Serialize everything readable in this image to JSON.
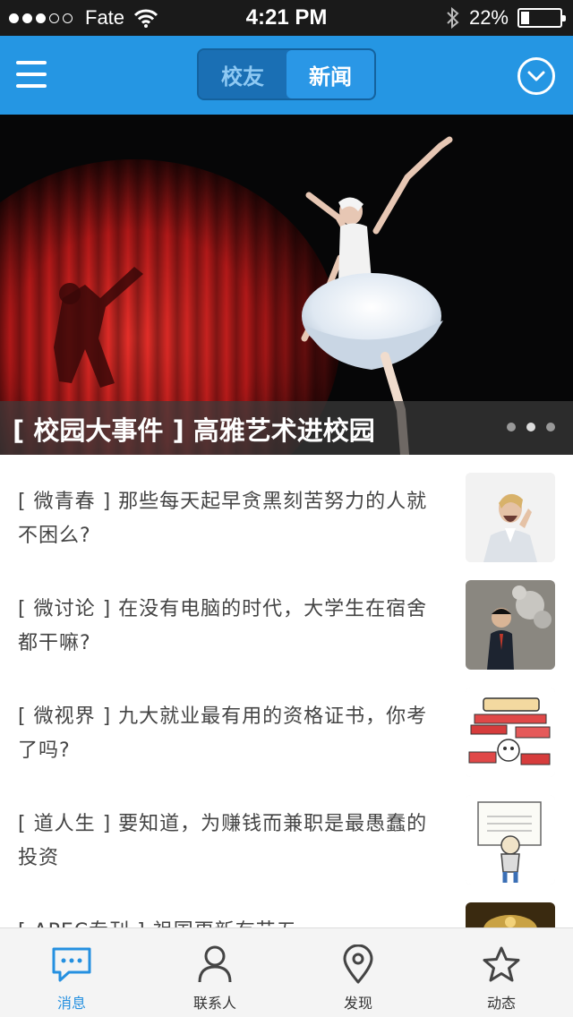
{
  "status_bar": {
    "carrier": "Fate",
    "time": "4:21 PM",
    "battery": "22%",
    "battery_level": 0.22,
    "signal_bars_filled": 3,
    "signal_bars_total": 5
  },
  "nav": {
    "segments": [
      {
        "label": "校友",
        "active": false
      },
      {
        "label": "新闻",
        "active": true
      }
    ],
    "accent_color": "#2596e3"
  },
  "hero": {
    "caption": "[ 校园大事件 ] 高雅艺术进校园",
    "page_count": 3,
    "current_page": 2
  },
  "news": [
    {
      "text": "[ 微青春 ] 那些每天起早贪黑刻苦努力的人就不困么?",
      "thumb_icon": "yawning-woman-photo"
    },
    {
      "text": "[ 微讨论 ] 在没有电脑的时代，大学生在宿舍都干嘛?",
      "thumb_icon": "thinking-man-photo"
    },
    {
      "text": "[ 微视界 ] 九大就业最有用的资格证书，你考了吗?",
      "thumb_icon": "certificate-books-cartoon"
    },
    {
      "text": "[ 道人生 ] 要知道，为赚钱而兼职是最愚蠢的投资",
      "thumb_icon": "part-time-job-cartoon"
    },
    {
      "text": "[ APEC专刊 ] 祖国更新有艺五",
      "thumb_icon": "apec-photo"
    }
  ],
  "tabs": [
    {
      "label": "消息",
      "icon": "message-icon",
      "active": true
    },
    {
      "label": "联系人",
      "icon": "contacts-icon",
      "active": false
    },
    {
      "label": "发现",
      "icon": "location-pin-icon",
      "active": false
    },
    {
      "label": "动态",
      "icon": "star-icon",
      "active": false
    }
  ]
}
